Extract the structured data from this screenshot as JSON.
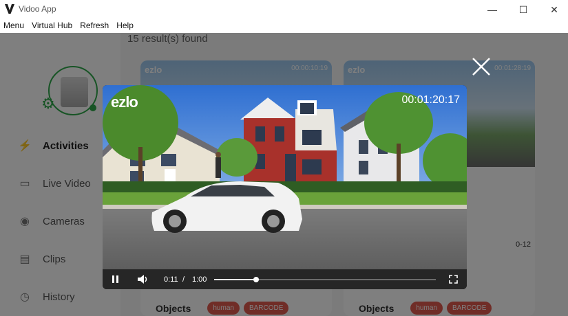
{
  "window": {
    "title": "Vidoo App",
    "minimize": "—",
    "maximize": "☐",
    "close": "✕"
  },
  "menu": [
    "Menu",
    "Virtual Hub",
    "Refresh",
    "Help"
  ],
  "sidebar": {
    "items": [
      {
        "label": "Activities",
        "icon": "lightning-icon"
      },
      {
        "label": "Live Video",
        "icon": "video-camera-icon"
      },
      {
        "label": "Cameras",
        "icon": "camera-icon"
      },
      {
        "label": "Clips",
        "icon": "clapperboard-icon"
      },
      {
        "label": "History",
        "icon": "clock-icon"
      }
    ]
  },
  "main": {
    "results_text": "15 result(s) found",
    "cards": [
      {
        "brand": "ezlo",
        "timestamp": "00:00:10:19",
        "objects_label": "Objects",
        "tags": [
          "human",
          "BARCODE"
        ]
      },
      {
        "brand": "ezlo",
        "timestamp": "00:01:28:19",
        "date_fragment": "0-12",
        "objects_label": "Objects",
        "tags": [
          "human",
          "BARCODE"
        ]
      }
    ]
  },
  "player": {
    "brand": "ezlo",
    "timestamp": "00:01:20:17",
    "current_time": "0:11",
    "separator": "/",
    "duration": "1:00",
    "progress": 0.19
  },
  "colors": {
    "accent_green": "#2ea84a",
    "tag_red": "#e05a4f",
    "controls_bg": "#262626"
  }
}
